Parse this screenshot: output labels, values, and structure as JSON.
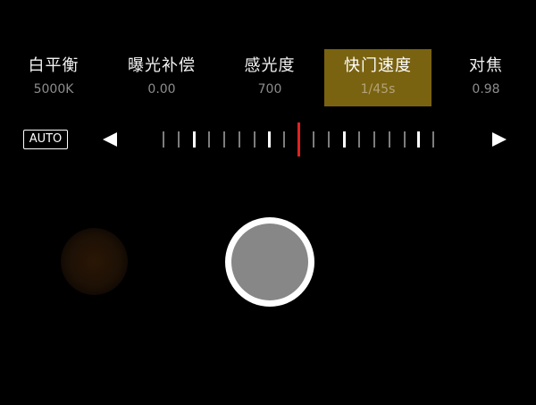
{
  "params": [
    {
      "label": "白平衡",
      "value": "5000K",
      "active": false
    },
    {
      "label": "曝光补偿",
      "value": "0.00",
      "active": false
    },
    {
      "label": "感光度",
      "value": "700",
      "active": false
    },
    {
      "label": "快门速度",
      "value": "1/45s",
      "active": true
    },
    {
      "label": "对焦",
      "value": "0.98",
      "active": false
    }
  ],
  "controls": {
    "auto_label": "AUTO",
    "prev_icon": "triangle-left-icon",
    "next_icon": "triangle-right-icon",
    "shutter_icon": "shutter-button"
  },
  "colors": {
    "background": "#000000",
    "active_param_bg": "#7a6310",
    "indicator": "#e02222",
    "tick_minor": "#7d7d7d",
    "tick_major": "#ffffff",
    "shutter_ring": "#ffffff",
    "shutter_fill": "#878787"
  }
}
